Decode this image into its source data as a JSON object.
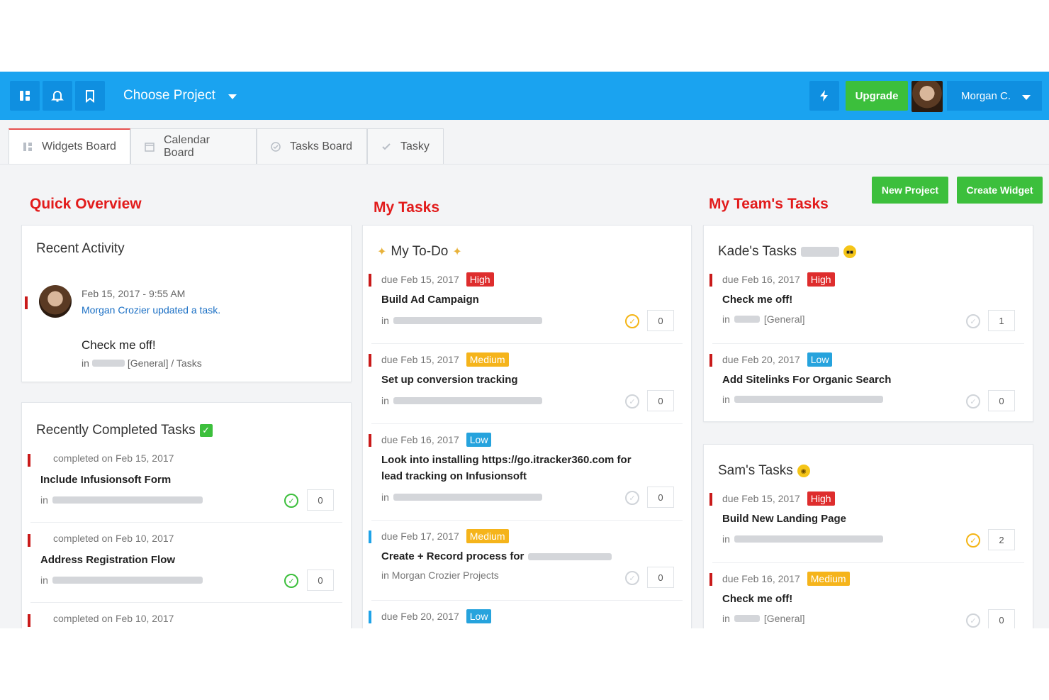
{
  "topbar": {
    "project_label": "Choose Project",
    "upgrade_label": "Upgrade",
    "user_name": "Morgan C."
  },
  "tabs": [
    {
      "label": "Widgets Board",
      "icon": "widgets-icon"
    },
    {
      "label": "Calendar Board",
      "icon": "calendar-icon"
    },
    {
      "label": "Tasks Board",
      "icon": "check-circle-icon"
    },
    {
      "label": "Tasky",
      "icon": "checkmark-icon"
    }
  ],
  "actions": {
    "new_project": "New Project",
    "create_widget": "Create Widget"
  },
  "sections": {
    "quick_overview": "Quick Overview",
    "my_tasks": "My Tasks",
    "team_tasks": "My Team's Tasks"
  },
  "recent_activity": {
    "title": "Recent Activity",
    "timestamp": "Feb 15, 2017 - 9:55 AM",
    "actor_text": "Morgan Crozier updated a task.",
    "task_name": "Check me off!",
    "location_prefix": "in",
    "location_text": "[General] / Tasks"
  },
  "recently_completed": {
    "title": "Recently Completed Tasks",
    "items": [
      {
        "completed": "completed on Feb 15, 2017",
        "name": "Include Infusionsoft Form",
        "in": "in",
        "count": "0"
      },
      {
        "completed": "completed on Feb 10, 2017",
        "name": "Address Registration Flow",
        "in": "in",
        "count": "0"
      },
      {
        "completed": "completed on Feb 10, 2017"
      }
    ]
  },
  "my_todo": {
    "title": "My To-Do",
    "items": [
      {
        "due": "due Feb 15, 2017",
        "priority": "High",
        "name": "Build Ad Campaign",
        "in": "in",
        "count": "0"
      },
      {
        "due": "due Feb 15, 2017",
        "priority": "Medium",
        "name": "Set up conversion tracking",
        "in": "in",
        "count": "0"
      },
      {
        "due": "due Feb 16, 2017",
        "priority": "Low",
        "name": "Look into installing https://go.itracker360.com for lead tracking on Infusionsoft",
        "in": "in",
        "count": "0"
      },
      {
        "due": "due Feb 17, 2017",
        "priority": "Medium",
        "name": "Create + Record process for",
        "in": "in Morgan Crozier Projects",
        "count": "0"
      },
      {
        "due": "due Feb 20, 2017",
        "priority": "Low"
      }
    ]
  },
  "kade_tasks": {
    "title": "Kade's Tasks",
    "items": [
      {
        "due": "due Feb 16, 2017",
        "priority": "High",
        "name": "Check me off!",
        "in": "in",
        "general": "[General]",
        "count": "1"
      },
      {
        "due": "due Feb 20, 2017",
        "priority": "Low",
        "name": "Add Sitelinks For Organic Search",
        "in": "in",
        "count": "0"
      }
    ]
  },
  "sam_tasks": {
    "title": "Sam's Tasks",
    "items": [
      {
        "due": "due Feb 15, 2017",
        "priority": "High",
        "name": "Build New Landing Page",
        "in": "in",
        "count": "2"
      },
      {
        "due": "due Feb 16, 2017",
        "priority": "Medium",
        "name": "Check me off!",
        "in": "in",
        "general": "[General]",
        "count": "0"
      }
    ]
  },
  "colors": {
    "topbar": "#1aa3f0",
    "green": "#3cbf3c",
    "section_title": "#e21b1b",
    "high": "#de2d2d",
    "medium": "#f5b41b",
    "low": "#26a3dd"
  }
}
